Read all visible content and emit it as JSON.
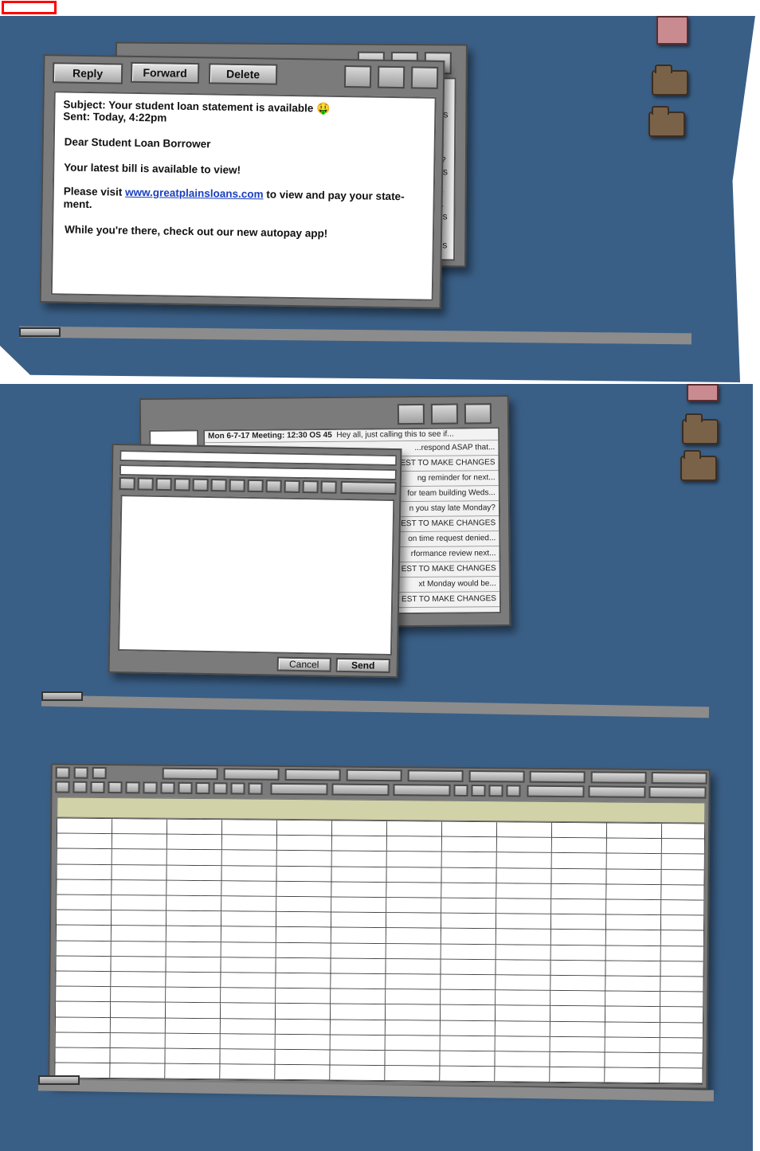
{
  "marker": {
    "color": "#ff0000"
  },
  "email_window": {
    "buttons": {
      "reply": "Reply",
      "forward": "Forward",
      "delete": "Delete"
    },
    "subject_line": "Subject: Your student loan statement is available",
    "subject_emoji": "🤑",
    "sent_line": "Sent: Today, 4:22pm",
    "greeting": "Dear Student Loan Borrower",
    "line1": "Your latest bill is available to view!",
    "line2_prefix": "Please visit ",
    "link": "www.greatplainsloans.com",
    "line2_suffix": " to view and pay your state-",
    "line2_wrap": "ment.",
    "line3": "While you're there, check out our new autopay app!"
  },
  "back_inbox_fragments": [
    "ES",
    "...",
    "y?",
    "ES",
    "...",
    "...",
    "ES",
    "ES"
  ],
  "inbox_window": {
    "first_row_bold": "Mon 6-7-17 Meeting: 12:30 OS 45",
    "first_row_rest": "Hey all, just calling this to see if...",
    "rows": [
      "...respond ASAP that...",
      "EST TO MAKE CHANGES",
      "ng reminder for next...",
      "for team building Weds...",
      "n you stay late Monday?",
      "EST TO MAKE CHANGES",
      "on time request denied...",
      "rformance review next...",
      "EST TO MAKE CHANGES",
      "xt Monday would be...",
      "EST TO MAKE CHANGES"
    ]
  },
  "compose_window": {
    "cancel": "Cancel",
    "send": "Send"
  },
  "colors": {
    "desktop": "#3a5f86",
    "window": "#7b7b7b",
    "spreadsheet_header": "#d2d2a8"
  }
}
